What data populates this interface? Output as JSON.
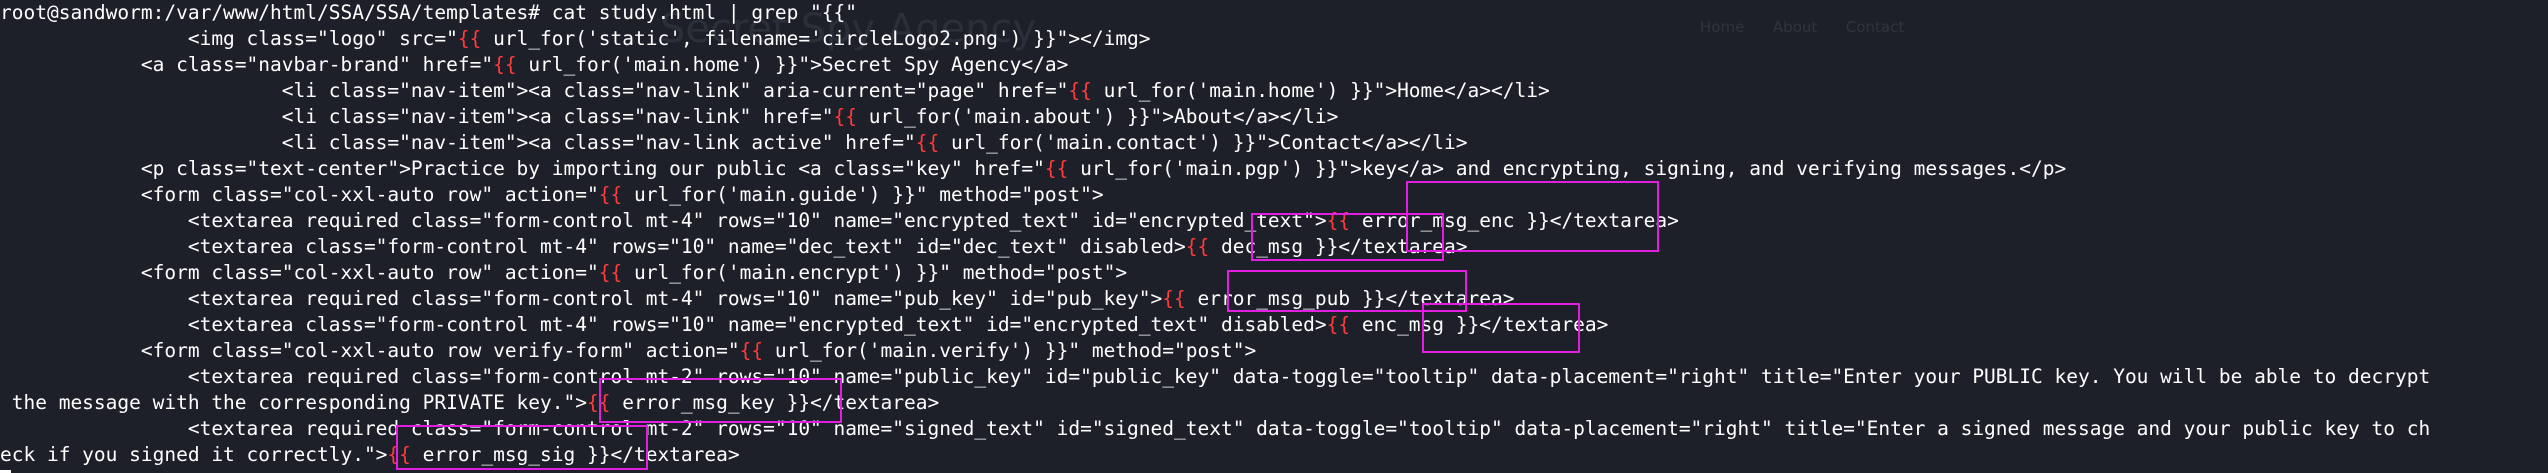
{
  "background_site": {
    "title": "Secret Spy Agency",
    "nav": [
      "Home",
      "About",
      "Contact"
    ]
  },
  "terminal": {
    "prompt": "root@sandworm:/var/www/html/SSA/SSA/templates#",
    "command": "cat study.html | grep \"{{\"",
    "lines": [
      [
        {
          "t": "root@sandworm:/var/www/html/SSA/SSA/templates# cat study.html | grep \"{{\""
        }
      ],
      [
        {
          "t": "                <img class=\"logo\" src=\""
        },
        {
          "t": "{{",
          "c": "red"
        },
        {
          "t": " url_for('static', filename='circleLogo2.png') }}\"></img>"
        }
      ],
      [
        {
          "t": "            <a class=\"navbar-brand\" href=\""
        },
        {
          "t": "{{",
          "c": "red"
        },
        {
          "t": " url_for('main.home') }}\">Secret Spy Agency</a>"
        }
      ],
      [
        {
          "t": "                        <li class=\"nav-item\"><a class=\"nav-link\" aria-current=\"page\" href=\""
        },
        {
          "t": "{{",
          "c": "red"
        },
        {
          "t": " url_for('main.home') }}\">Home</a></li>"
        }
      ],
      [
        {
          "t": "                        <li class=\"nav-item\"><a class=\"nav-link\" href=\""
        },
        {
          "t": "{{",
          "c": "red"
        },
        {
          "t": " url_for('main.about') }}\">About</a></li>"
        }
      ],
      [
        {
          "t": "                        <li class=\"nav-item\"><a class=\"nav-link active\" href=\""
        },
        {
          "t": "{{",
          "c": "red"
        },
        {
          "t": " url_for('main.contact') }}\">Contact</a></li>"
        }
      ],
      [
        {
          "t": "            <p class=\"text-center\">Practice by importing our public <a class=\"key\" href=\""
        },
        {
          "t": "{{",
          "c": "red"
        },
        {
          "t": " url_for('main.pgp') }}\">key</a> and encrypting, signing, and verifying messages.</p>"
        }
      ],
      [
        {
          "t": "            <form class=\"col-xxl-auto row\" action=\""
        },
        {
          "t": "{{",
          "c": "red"
        },
        {
          "t": " url_for('main.guide') }}\" method=\"post\">"
        }
      ],
      [
        {
          "t": "                <textarea required class=\"form-control mt-4\" rows=\"10\" name=\"encrypted_text\" id=\"encrypted_text\">"
        },
        {
          "t": "{{",
          "c": "red"
        },
        {
          "t": " error_msg_enc }}</textarea>"
        }
      ],
      [
        {
          "t": "                <textarea class=\"form-control mt-4\" rows=\"10\" name=\"dec_text\" id=\"dec_text\" disabled>"
        },
        {
          "t": "{{",
          "c": "red"
        },
        {
          "t": " dec_msg }}</textarea>"
        }
      ],
      [
        {
          "t": "            <form class=\"col-xxl-auto row\" action=\""
        },
        {
          "t": "{{",
          "c": "red"
        },
        {
          "t": " url_for('main.encrypt') }}\" method=\"post\">"
        }
      ],
      [
        {
          "t": "                <textarea required class=\"form-control mt-4\" rows=\"10\" name=\"pub_key\" id=\"pub_key\">"
        },
        {
          "t": "{{",
          "c": "red"
        },
        {
          "t": " error_msg_pub }}</textarea>"
        }
      ],
      [
        {
          "t": "                <textarea class=\"form-control mt-4\" rows=\"10\" name=\"encrypted_text\" id=\"encrypted_text\" disabled>"
        },
        {
          "t": "{{",
          "c": "red"
        },
        {
          "t": " enc_msg }}</textarea>"
        }
      ],
      [
        {
          "t": "            <form class=\"col-xxl-auto row verify-form\" action=\""
        },
        {
          "t": "{{",
          "c": "red"
        },
        {
          "t": " url_for('main.verify') }}\" method=\"post\">"
        }
      ],
      [
        {
          "t": "                <textarea required class=\"form-control mt-2\" rows=\"10\" name=\"public_key\" id=\"public_key\" data-toggle=\"tooltip\" data-placement=\"right\" title=\"Enter your PUBLIC key. You will be able to decrypt"
        }
      ],
      [
        {
          "t": " the message with the corresponding PRIVATE key.\">"
        },
        {
          "t": "{{",
          "c": "red"
        },
        {
          "t": " error_msg_key }}</textarea>"
        }
      ],
      [
        {
          "t": "                <textarea required class=\"form-control mt-2\" rows=\"10\" name=\"signed_text\" id=\"signed_text\" data-toggle=\"tooltip\" data-placement=\"right\" title=\"Enter a signed message and your public key to ch"
        }
      ],
      [
        {
          "t": "eck if you signed it correctly.\">"
        },
        {
          "t": "{{",
          "c": "red"
        },
        {
          "t": " error_msg_sig }}</textarea>"
        }
      ]
    ],
    "highlight_colors": {
      "box": "#e21ee0",
      "template_brace": "#ff3b3b",
      "background": "#1d2029",
      "text": "#ffffff"
    }
  }
}
